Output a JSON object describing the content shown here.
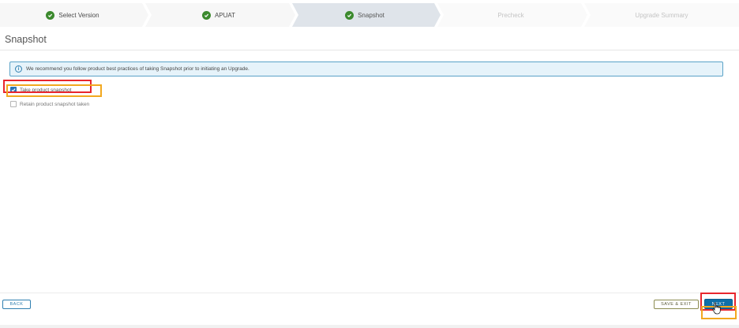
{
  "stepper": {
    "steps": [
      {
        "label": "Select Version",
        "state": "complete"
      },
      {
        "label": "APUAT",
        "state": "complete"
      },
      {
        "label": "Snapshot",
        "state": "current"
      },
      {
        "label": "Precheck",
        "state": "pending"
      },
      {
        "label": "Upgrade Summary",
        "state": "pending"
      }
    ],
    "icon": "check-circle-icon",
    "complete_color": "#3c8a2e",
    "current_bg": "#dfe4ea"
  },
  "page": {
    "title": "Snapshot"
  },
  "banner": {
    "icon": "info-circle-icon",
    "text": "We recommend you follow product best practices of taking Snapshot prior to initiating an Upgrade.",
    "border_color": "#5aa2c7"
  },
  "options": [
    {
      "label": "Take product snapshot",
      "checked": true
    },
    {
      "label": "Retain product snapshot taken",
      "checked": false
    }
  ],
  "footer": {
    "back_label": "BACK",
    "save_exit_label": "SAVE & EXIT",
    "next_label": "NEXT"
  },
  "annotations": {
    "highlight_colors": [
      "#e8262d",
      "#f2a81f"
    ]
  }
}
